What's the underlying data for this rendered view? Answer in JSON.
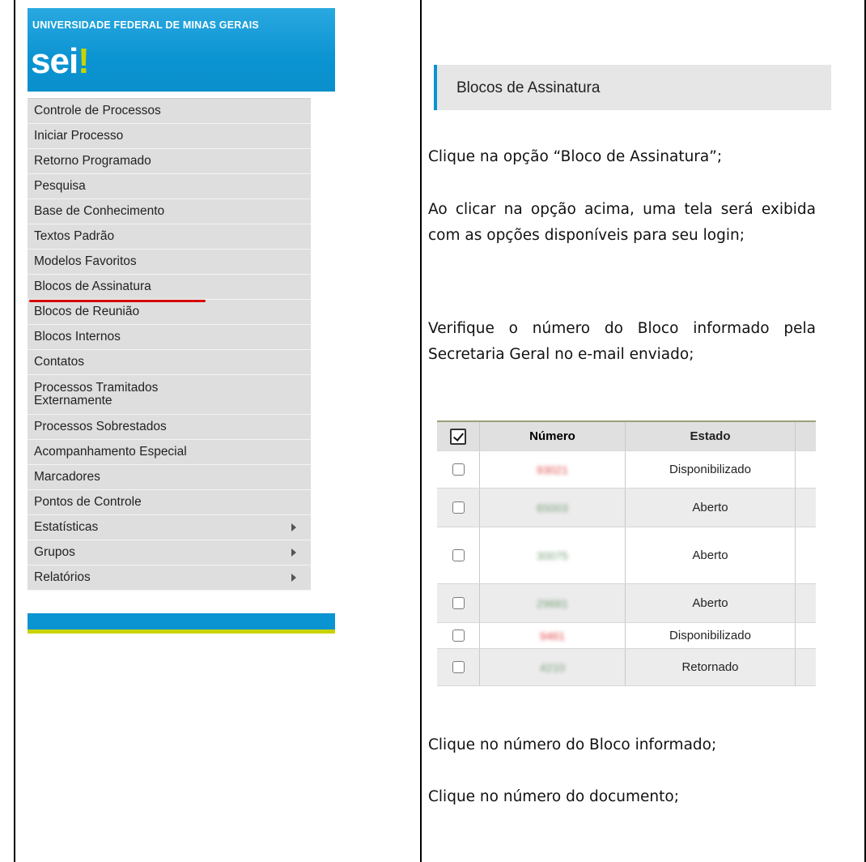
{
  "sidebar": {
    "university": "UNIVERSIDADE FEDERAL DE MINAS GERAIS",
    "logo": "sei!",
    "menu": [
      {
        "label": "Controle de Processos",
        "submenu": false
      },
      {
        "label": "Iniciar Processo",
        "submenu": false
      },
      {
        "label": "Retorno Programado",
        "submenu": false
      },
      {
        "label": "Pesquisa",
        "submenu": false
      },
      {
        "label": "Base de Conhecimento",
        "submenu": false
      },
      {
        "label": "Textos Padrão",
        "submenu": false
      },
      {
        "label": "Modelos Favoritos",
        "submenu": false
      },
      {
        "label": "Blocos de Assinatura",
        "submenu": false,
        "highlighted": true
      },
      {
        "label": "Blocos de Reunião",
        "submenu": false
      },
      {
        "label": "Blocos Internos",
        "submenu": false
      },
      {
        "label": "Contatos",
        "submenu": false
      },
      {
        "label": "Processos Tramitados Externamente",
        "submenu": false
      },
      {
        "label": "Processos Sobrestados",
        "submenu": false
      },
      {
        "label": "Acompanhamento Especial",
        "submenu": false
      },
      {
        "label": "Marcadores",
        "submenu": false
      },
      {
        "label": "Pontos de Controle",
        "submenu": false
      },
      {
        "label": "Estatísticas",
        "submenu": true
      },
      {
        "label": "Grupos",
        "submenu": true
      },
      {
        "label": "Relatórios",
        "submenu": true
      }
    ],
    "colors": {
      "brand_blue": "#0b94d2",
      "brand_green": "#c8d400",
      "highlight_red": "#d40000"
    }
  },
  "content": {
    "section_header": "Blocos de Assinatura",
    "instructions": [
      "Clique na opção “Bloco de Assinatura”;",
      "Ao clicar na opção acima, uma tela será exibida com as opções disponíveis para seu login;",
      "Verifique o número do Bloco informado pela Secretaria Geral no e-mail enviado;",
      "Clique no número do Bloco informado;",
      "Clique no número do documento;"
    ]
  },
  "blocks_table": {
    "headers": {
      "numero": "Número",
      "estado": "Estado"
    },
    "rows": [
      {
        "numero": "93021",
        "estado": "Disponibilizado",
        "color": "red"
      },
      {
        "numero": "65003",
        "estado": "Aberto",
        "color": "green"
      },
      {
        "numero": "30075",
        "estado": "Aberto",
        "color": "green"
      },
      {
        "numero": "29681",
        "estado": "Aberto",
        "color": "green"
      },
      {
        "numero": "9461",
        "estado": "Disponibilizado",
        "color": "red"
      },
      {
        "numero": "4210",
        "estado": "Retornado",
        "color": "green"
      }
    ]
  }
}
